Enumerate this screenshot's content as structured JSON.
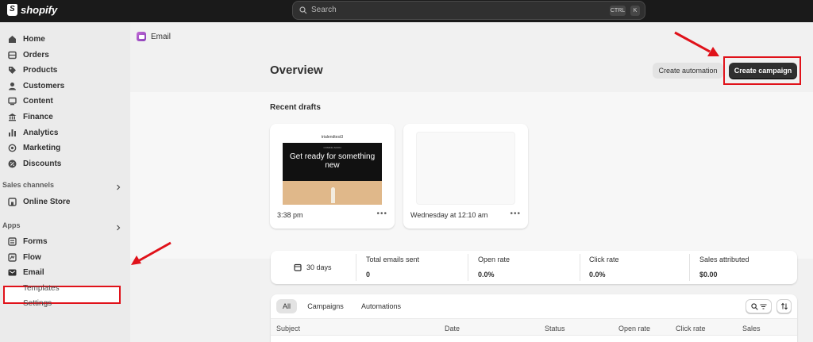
{
  "topbar": {
    "brand": "shopify",
    "search_placeholder": "Search",
    "shortcut_ctrl": "CTRL",
    "shortcut_key": "K"
  },
  "sidebar": {
    "main_items": [
      {
        "label": "Home",
        "icon": "home-icon"
      },
      {
        "label": "Orders",
        "icon": "orders-icon"
      },
      {
        "label": "Products",
        "icon": "tag-icon"
      },
      {
        "label": "Customers",
        "icon": "person-icon"
      },
      {
        "label": "Content",
        "icon": "content-icon"
      },
      {
        "label": "Finance",
        "icon": "bank-icon"
      },
      {
        "label": "Analytics",
        "icon": "bar-chart-icon"
      },
      {
        "label": "Marketing",
        "icon": "target-icon"
      },
      {
        "label": "Discounts",
        "icon": "discount-icon"
      }
    ],
    "sales_channels_label": "Sales channels",
    "online_store_label": "Online Store",
    "apps_label": "Apps",
    "app_items": [
      {
        "label": "Forms",
        "icon": "forms-icon"
      },
      {
        "label": "Flow",
        "icon": "flow-icon"
      },
      {
        "label": "Email",
        "icon": "email-icon"
      }
    ],
    "email_sub_items": [
      "Templates",
      "Settings"
    ]
  },
  "main": {
    "breadcrumb": "Email",
    "title": "Overview",
    "create_automation_label": "Create automation",
    "create_campaign_label": "Create campaign",
    "recent_drafts_label": "Recent drafts",
    "drafts": [
      {
        "time": "3:38 pm",
        "preview_header": "trialendtest3",
        "preview_kicker": "COMING SOON",
        "preview_headline": "Get ready for something new"
      },
      {
        "time": "Wednesday at 12:10 am"
      }
    ],
    "stats": {
      "period": "30 days",
      "items": [
        {
          "label": "Total emails sent",
          "value": "0"
        },
        {
          "label": "Open rate",
          "value": "0.0%"
        },
        {
          "label": "Click rate",
          "value": "0.0%"
        },
        {
          "label": "Sales attributed",
          "value": "$0.00"
        }
      ]
    },
    "tabs": [
      "All",
      "Campaigns",
      "Automations"
    ],
    "table_columns": [
      "Subject",
      "Date",
      "Status",
      "Open rate",
      "Click rate",
      "Sales"
    ]
  },
  "colors": {
    "highlight_red": "#e0121a",
    "topbar": "#1a1a1a",
    "primary_button": "#303030"
  }
}
